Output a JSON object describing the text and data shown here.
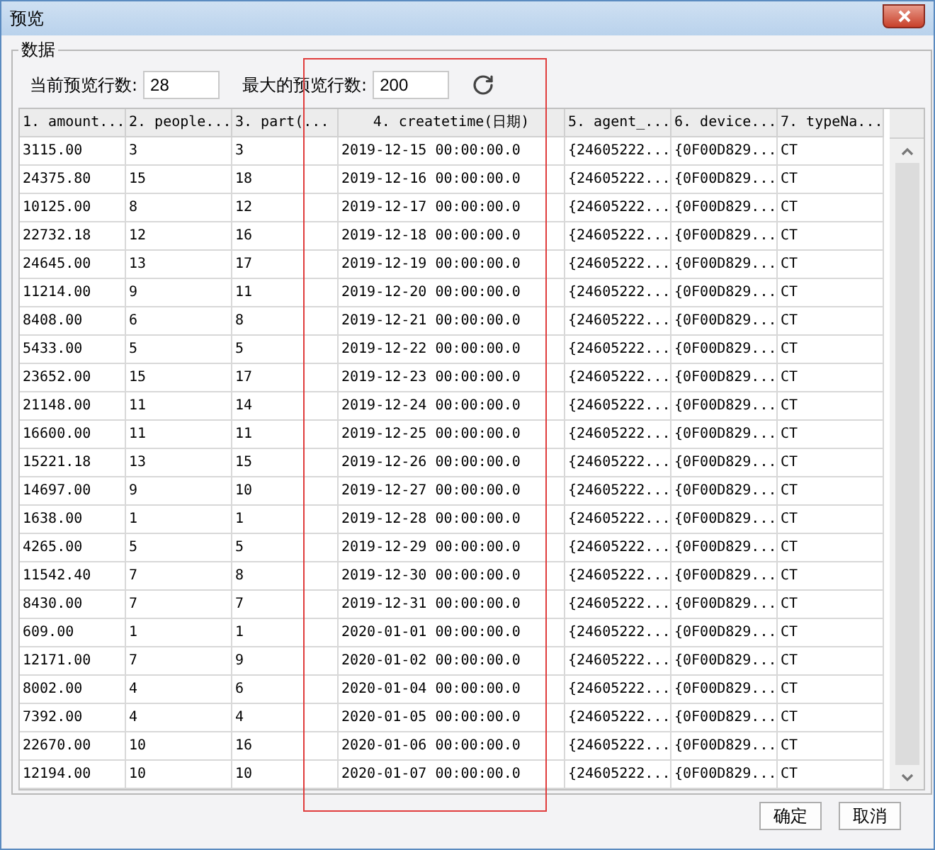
{
  "window": {
    "title": "预览"
  },
  "group": {
    "title": "数据"
  },
  "current_rows": {
    "label": "当前预览行数:",
    "value": "28"
  },
  "max_rows": {
    "label": "最大的预览行数:",
    "value": "200"
  },
  "table": {
    "columns": [
      {
        "label": "1. amount...",
        "kind": "text"
      },
      {
        "label": "2. people...",
        "kind": "text"
      },
      {
        "label": "3. part(...",
        "kind": "text"
      },
      {
        "label": "4. createtime(日期)",
        "kind": "date"
      },
      {
        "label": "5. agent_...",
        "kind": "text"
      },
      {
        "label": "6. device...",
        "kind": "text"
      },
      {
        "label": "7. typeNa...",
        "kind": "text"
      }
    ],
    "rows": [
      [
        "3115.00",
        "3",
        "3",
        "2019-12-15 00:00:00.0",
        "{24605222...",
        "{0F00D829...",
        "CT"
      ],
      [
        "24375.80",
        "15",
        "18",
        "2019-12-16 00:00:00.0",
        "{24605222...",
        "{0F00D829...",
        "CT"
      ],
      [
        "10125.00",
        "8",
        "12",
        "2019-12-17 00:00:00.0",
        "{24605222...",
        "{0F00D829...",
        "CT"
      ],
      [
        "22732.18",
        "12",
        "16",
        "2019-12-18 00:00:00.0",
        "{24605222...",
        "{0F00D829...",
        "CT"
      ],
      [
        "24645.00",
        "13",
        "17",
        "2019-12-19 00:00:00.0",
        "{24605222...",
        "{0F00D829...",
        "CT"
      ],
      [
        "11214.00",
        "9",
        "11",
        "2019-12-20 00:00:00.0",
        "{24605222...",
        "{0F00D829...",
        "CT"
      ],
      [
        "8408.00",
        "6",
        "8",
        "2019-12-21 00:00:00.0",
        "{24605222...",
        "{0F00D829...",
        "CT"
      ],
      [
        "5433.00",
        "5",
        "5",
        "2019-12-22 00:00:00.0",
        "{24605222...",
        "{0F00D829...",
        "CT"
      ],
      [
        "23652.00",
        "15",
        "17",
        "2019-12-23 00:00:00.0",
        "{24605222...",
        "{0F00D829...",
        "CT"
      ],
      [
        "21148.00",
        "11",
        "14",
        "2019-12-24 00:00:00.0",
        "{24605222...",
        "{0F00D829...",
        "CT"
      ],
      [
        "16600.00",
        "11",
        "11",
        "2019-12-25 00:00:00.0",
        "{24605222...",
        "{0F00D829...",
        "CT"
      ],
      [
        "15221.18",
        "13",
        "15",
        "2019-12-26 00:00:00.0",
        "{24605222...",
        "{0F00D829...",
        "CT"
      ],
      [
        "14697.00",
        "9",
        "10",
        "2019-12-27 00:00:00.0",
        "{24605222...",
        "{0F00D829...",
        "CT"
      ],
      [
        "1638.00",
        "1",
        "1",
        "2019-12-28 00:00:00.0",
        "{24605222...",
        "{0F00D829...",
        "CT"
      ],
      [
        "4265.00",
        "5",
        "5",
        "2019-12-29 00:00:00.0",
        "{24605222...",
        "{0F00D829...",
        "CT"
      ],
      [
        "11542.40",
        "7",
        "8",
        "2019-12-30 00:00:00.0",
        "{24605222...",
        "{0F00D829...",
        "CT"
      ],
      [
        "8430.00",
        "7",
        "7",
        "2019-12-31 00:00:00.0",
        "{24605222...",
        "{0F00D829...",
        "CT"
      ],
      [
        "609.00",
        "1",
        "1",
        "2020-01-01 00:00:00.0",
        "{24605222...",
        "{0F00D829...",
        "CT"
      ],
      [
        "12171.00",
        "7",
        "9",
        "2020-01-02 00:00:00.0",
        "{24605222...",
        "{0F00D829...",
        "CT"
      ],
      [
        "8002.00",
        "4",
        "6",
        "2020-01-04 00:00:00.0",
        "{24605222...",
        "{0F00D829...",
        "CT"
      ],
      [
        "7392.00",
        "4",
        "4",
        "2020-01-05 00:00:00.0",
        "{24605222...",
        "{0F00D829...",
        "CT"
      ],
      [
        "22670.00",
        "10",
        "16",
        "2020-01-06 00:00:00.0",
        "{24605222...",
        "{0F00D829...",
        "CT"
      ],
      [
        "12194.00",
        "10",
        "10",
        "2020-01-07 00:00:00.0",
        "{24605222...",
        "{0F00D829...",
        "CT"
      ]
    ]
  },
  "highlight": {
    "kind": "frame",
    "color": "#e03c3c"
  },
  "buttons": [
    "确定",
    "取消"
  ]
}
